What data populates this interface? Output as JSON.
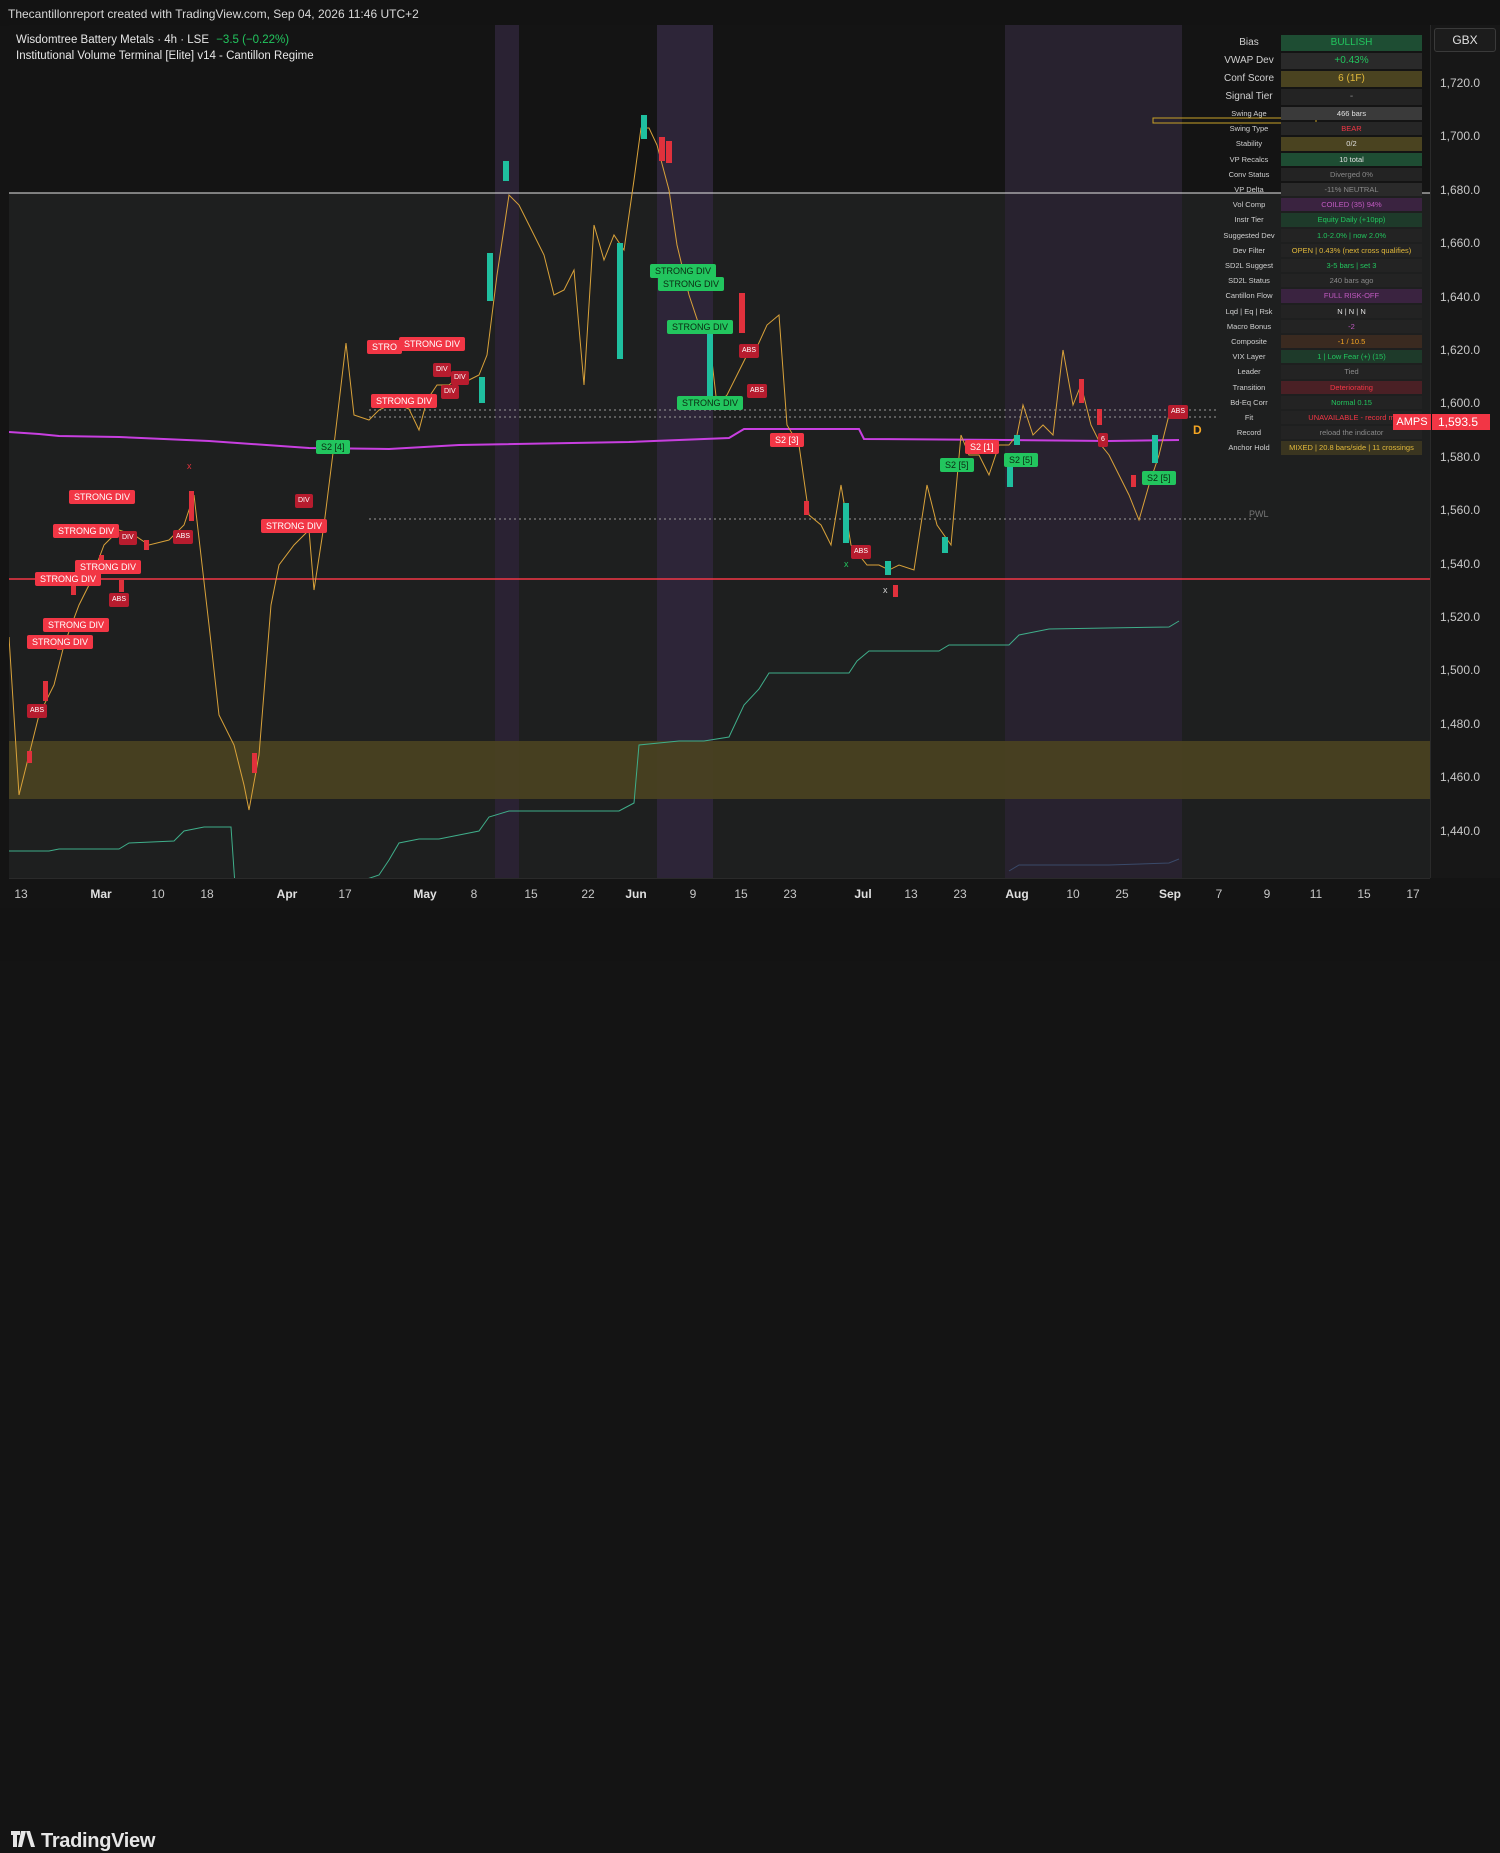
{
  "header": {
    "attribution": "Thecantillonreport created with TradingView.com, Sep 04, 2026 11:46 UTC+2"
  },
  "legend": {
    "symbol": "Wisdomtree Battery Metals · 4h · LSE",
    "change": "−3.5 (−0.22%)",
    "indicator": "Institutional Volume Terminal [Elite] v14 - Cantillon Regime"
  },
  "price_axis": {
    "currency": "GBX",
    "ticks": [
      "1,720.0",
      "1,700.0",
      "1,680.0",
      "1,660.0",
      "1,640.0",
      "1,620.0",
      "1,600.0",
      "1,580.0",
      "1,560.0",
      "1,540.0",
      "1,520.0",
      "1,500.0",
      "1,480.0",
      "1,460.0",
      "1,440.0"
    ],
    "last_price": "1,593.5",
    "amps_label": "AMPS"
  },
  "time_axis": {
    "ticks": [
      {
        "label": "13",
        "bold": false
      },
      {
        "label": "Mar",
        "bold": true
      },
      {
        "label": "10",
        "bold": false
      },
      {
        "label": "18",
        "bold": false
      },
      {
        "label": "Apr",
        "bold": true
      },
      {
        "label": "17",
        "bold": false
      },
      {
        "label": "May",
        "bold": true
      },
      {
        "label": "8",
        "bold": false
      },
      {
        "label": "15",
        "bold": false
      },
      {
        "label": "22",
        "bold": false
      },
      {
        "label": "Jun",
        "bold": true
      },
      {
        "label": "9",
        "bold": false
      },
      {
        "label": "15",
        "bold": false
      },
      {
        "label": "23",
        "bold": false
      },
      {
        "label": "Jul",
        "bold": true
      },
      {
        "label": "13",
        "bold": false
      },
      {
        "label": "23",
        "bold": false
      },
      {
        "label": "Aug",
        "bold": true
      },
      {
        "label": "10",
        "bold": false
      },
      {
        "label": "25",
        "bold": false
      },
      {
        "label": "Sep",
        "bold": true
      },
      {
        "label": "7",
        "bold": false
      },
      {
        "label": "9",
        "bold": false
      },
      {
        "label": "11",
        "bold": false
      },
      {
        "label": "15",
        "bold": false
      },
      {
        "label": "17",
        "bold": false
      }
    ]
  },
  "status_table": [
    {
      "label": "Bias",
      "value": "BULLISH",
      "color": "#22c55e",
      "bg": "#1e4d33"
    },
    {
      "label": "VWAP Dev",
      "value": "+0.43%",
      "color": "#22c55e",
      "bg": "#2a2a2a"
    },
    {
      "label": "Conf Score",
      "value": "6 (1F)",
      "color": "#e2b93b",
      "bg": "#4a4320"
    },
    {
      "label": "Signal Tier",
      "value": "-",
      "color": "#8a8a8a",
      "bg": "#232323"
    },
    {
      "label": "Swing Age",
      "value": "466 bars",
      "color": "#e0e0e0",
      "bg": "#3a3a3a"
    },
    {
      "label": "Swing Type",
      "value": "BEAR",
      "color": "#f23645",
      "bg": "#262626"
    },
    {
      "label": "Stability",
      "value": "0/2",
      "color": "#e0e0e0",
      "bg": "#4a4320"
    },
    {
      "label": "VP Recalcs",
      "value": "10 total",
      "color": "#e0e0e0",
      "bg": "#1e4d33"
    },
    {
      "label": "Conv Status",
      "value": "Diverged 0%",
      "color": "#8a8a8a",
      "bg": "#232323"
    },
    {
      "label": "VP Delta",
      "value": "-11% NEUTRAL",
      "color": "#8a8a8a",
      "bg": "#2a2a2a"
    },
    {
      "label": "Vol Comp",
      "value": "COILED (35) 94%",
      "color": "#c05ac0",
      "bg": "#3a2340"
    },
    {
      "label": "Instr Tier",
      "value": "Equity Daily (+10pp)",
      "color": "#22c55e",
      "bg": "#1e3a2a"
    },
    {
      "label": "Suggested Dev",
      "value": "1.0-2.0% | now 2.0%",
      "color": "#22c55e",
      "bg": "#232323"
    },
    {
      "label": "Dev Filter",
      "value": "OPEN | 0.43% (next cross qualifies)",
      "color": "#e2b93b",
      "bg": "#232323"
    },
    {
      "label": "SD2L Suggest",
      "value": "3-5 bars | set 3",
      "color": "#22c55e",
      "bg": "#232323"
    },
    {
      "label": "SD2L Status",
      "value": "240 bars ago",
      "color": "#8a8a8a",
      "bg": "#232323"
    },
    {
      "label": "Cantillon Flow",
      "value": "FULL RISK-OFF",
      "color": "#c05ac0",
      "bg": "#3a2340"
    },
    {
      "label": "Lqd | Eq | Rsk",
      "value": "N | N | N",
      "color": "#e0e0e0",
      "bg": "#232323"
    },
    {
      "label": "Macro Bonus",
      "value": "-2",
      "color": "#c05ac0",
      "bg": "#232323"
    },
    {
      "label": "Composite",
      "value": "-1 / 10.5",
      "color": "#f5a623",
      "bg": "#3a2a20"
    },
    {
      "label": "VIX Layer",
      "value": "1 | Low Fear (+) (15)",
      "color": "#22c55e",
      "bg": "#1e3a2a"
    },
    {
      "label": "Leader",
      "value": "Tied",
      "color": "#8a8a8a",
      "bg": "#232323"
    },
    {
      "label": "Transition",
      "value": "Deteriorating",
      "color": "#f23645",
      "bg": "#4a2025"
    },
    {
      "label": "Bd-Eq Corr",
      "value": "Normal 0.15",
      "color": "#22c55e",
      "bg": "#232323"
    },
    {
      "label": "Fit",
      "value": "UNAVAILABLE - record m",
      "color": "#f23645",
      "bg": "#232323"
    },
    {
      "label": "Record",
      "value": "reload the indicator",
      "color": "#8a8a8a",
      "bg": "#232323"
    },
    {
      "label": "Anchor Hold",
      "value": "MIXED | 20.8 bars/side | 11 crossings",
      "color": "#e2b93b",
      "bg": "#3a3520"
    }
  ],
  "signals": {
    "strong_div": "STRONG DIV",
    "div": "DIV",
    "abs": "ABS",
    "s2_4": "S2 [4]",
    "s2_5": "S2 [5]",
    "s2_3": "S2 [3]",
    "s2_1": "S2 [1]",
    "d_marker": "D",
    "pwl": "PWL",
    "num_6": "6",
    "x_marker": "x",
    "strong_div_truncated": "STRO"
  },
  "colors": {
    "background": "#1e1f1f",
    "up_candle": "#1fbf9f",
    "down_candle": "#e0313c",
    "vwap": "#c83fe0",
    "price_line": "#d9a23a",
    "support_line": "#f23645",
    "cumulative": "#3fae8a",
    "yellow_zone": "#4a4320",
    "purple_band": "#2a2233"
  },
  "footer": {
    "brand": "TradingView"
  }
}
